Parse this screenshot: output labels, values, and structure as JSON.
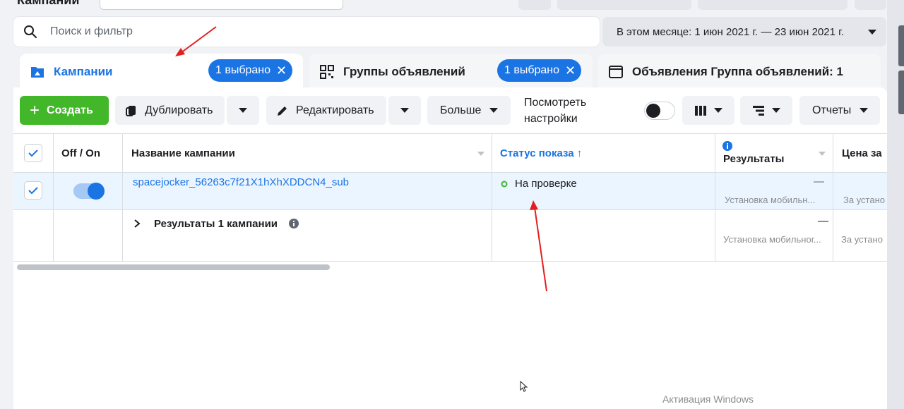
{
  "top": {
    "title": "Кампании"
  },
  "search": {
    "placeholder": "Поиск и фильтр"
  },
  "date_range": {
    "label": "В этом месяце: 1 июн 2021 г. — 23 июн 2021 г."
  },
  "tabs": [
    {
      "label": "Кампании",
      "selected_pill": "1 выбрано",
      "icon": "folder-icon"
    },
    {
      "label": "Группы объявлений",
      "selected_pill": "1 выбрано",
      "icon": "grid-icon"
    },
    {
      "label": "Объявления Группа объявлений: 1",
      "icon": "ad-window-icon"
    }
  ],
  "toolbar": {
    "create": "Создать",
    "duplicate": "Дублировать",
    "edit": "Редактировать",
    "more": "Больше",
    "view_settings": "Посмотреть настройки",
    "reports": "Отчеты"
  },
  "table": {
    "columns": {
      "off_on": "Off / On",
      "name": "Название кампании",
      "status": "Статус показа ↑",
      "results": "Результаты",
      "cost": "Цена за"
    },
    "rows": [
      {
        "name": "spacejocker_56263c7f21X1hXhXDDCN4_sub",
        "status": "На проверке",
        "results_value": "—",
        "results_sub": "Установка мобильн...",
        "cost_sub": "За устано"
      }
    ],
    "summary": {
      "label": "Результаты 1 кампании",
      "results_value": "—",
      "results_sub": "Установка мобильног...",
      "cost_sub": "За устано"
    }
  },
  "watermark": "Активация Windows",
  "colors": {
    "accent": "#1b74e4",
    "create": "#42b72a",
    "status_dot": "#42b72a",
    "annotation": "#e41e1e"
  }
}
